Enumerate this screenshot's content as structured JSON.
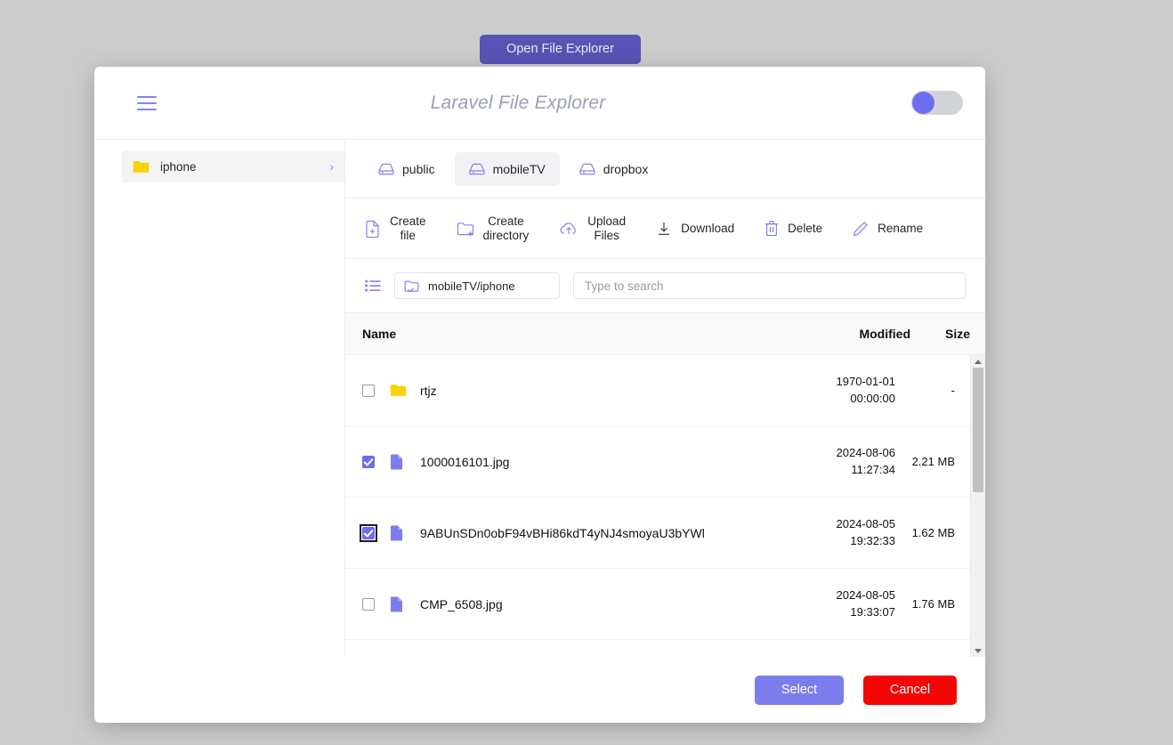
{
  "page": {
    "background_color": "#cccccc",
    "open_button_label": "Open File Explorer"
  },
  "modal": {
    "title": "Laravel File Explorer",
    "hamburger_icon": "hamburger-menu-icon",
    "toggle": {
      "state": "off",
      "knob_color": "#6c6ef0",
      "track_color": "#d2d3d8"
    }
  },
  "sidebar": {
    "items": [
      {
        "label": "iphone",
        "icon": "folder-icon",
        "selected": true,
        "chevron": "›"
      }
    ]
  },
  "disks": {
    "items": [
      {
        "label": "public",
        "icon": "hard-drive-icon",
        "active": false
      },
      {
        "label": "mobileTV",
        "icon": "hard-drive-icon",
        "active": true
      },
      {
        "label": "dropbox",
        "icon": "hard-drive-icon",
        "active": false
      }
    ]
  },
  "toolbar": {
    "actions": [
      {
        "label": "Create file",
        "lines": [
          "Create",
          "file"
        ],
        "icon": "file-plus-icon"
      },
      {
        "label": "Create directory",
        "lines": [
          "Create",
          "directory"
        ],
        "icon": "folder-plus-icon"
      },
      {
        "label": "Upload Files",
        "lines": [
          "Upload",
          "Files"
        ],
        "icon": "cloud-upload-icon"
      },
      {
        "label": "Download",
        "lines": [
          "Download"
        ],
        "icon": "download-icon"
      },
      {
        "label": "Delete",
        "lines": [
          "Delete"
        ],
        "icon": "trash-icon"
      },
      {
        "label": "Rename",
        "lines": [
          "Rename"
        ],
        "icon": "pencil-icon"
      }
    ]
  },
  "search_row": {
    "view_icon": "list-view-icon",
    "path_icon": "folder-check-icon",
    "path_value": "mobileTV/iphone",
    "search_value": "",
    "search_placeholder": "Type to search"
  },
  "table": {
    "columns": {
      "name": "Name",
      "modified": "Modified",
      "size": "Size"
    },
    "rows": [
      {
        "name": "rtjz",
        "type": "folder",
        "icon": "folder-icon",
        "checked": false,
        "focused": false,
        "modified_date": "1970-01-01",
        "modified_time": "00:00:00",
        "size": "-"
      },
      {
        "name": "1000016101.jpg",
        "type": "file",
        "icon": "file-icon",
        "checked": true,
        "focused": false,
        "modified_date": "2024-08-06",
        "modified_time": "11:27:34",
        "size": "2.21 MB"
      },
      {
        "name": "9ABUnSDn0obF94vBHi86kdT4yNJ4smoyaU3bYWl",
        "type": "file",
        "icon": "file-icon",
        "checked": true,
        "focused": true,
        "modified_date": "2024-08-05",
        "modified_time": "19:32:33",
        "size": "1.62 MB"
      },
      {
        "name": "CMP_6508.jpg",
        "type": "file",
        "icon": "file-icon",
        "checked": false,
        "focused": false,
        "modified_date": "2024-08-05",
        "modified_time": "19:33:07",
        "size": "1.76 MB"
      }
    ]
  },
  "scrollbar": {
    "up_icon": "scroll-up-arrow-icon",
    "down_icon": "scroll-down-arrow-icon",
    "thumb_percent": 45
  },
  "footer": {
    "select_label": "Select",
    "cancel_label": "Cancel",
    "select_color": "#7b7ded",
    "cancel_color": "#f50606"
  },
  "colors": {
    "accent_purple": "#6c6ef0",
    "brand_purple": "#5a52b5",
    "folder_yellow": "#f5d400",
    "file_purple": "#7b7ded"
  }
}
